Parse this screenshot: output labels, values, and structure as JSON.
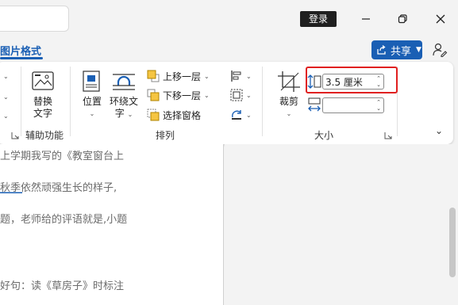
{
  "titlebar": {
    "login_label": "登录"
  },
  "tabs": {
    "active_label": "图片格式",
    "share_label": "共享"
  },
  "ribbon": {
    "accessibility": {
      "alt_text_line1": "替换",
      "alt_text_line2": "文字",
      "group_label": "辅助功能"
    },
    "arrange": {
      "position_label": "位置",
      "wrap_text_line1": "环绕文",
      "wrap_text_line2": "字",
      "bring_forward_label": "上移一层",
      "send_backward_label": "下移一层",
      "selection_pane_label": "选择窗格",
      "group_label": "排列"
    },
    "size": {
      "crop_label": "裁剪",
      "height_value": "3.5 厘米",
      "width_value": "",
      "group_label": "大小"
    }
  },
  "document": {
    "lines": [
      "上学期我写的《教室窗台上",
      "秋季依然顽强生长的样子,",
      "题，老师给的评语就是,小题",
      "好句：读《草房子》时标注"
    ]
  },
  "colors": {
    "accent": "#1a5fb4",
    "highlight": "#e02020"
  }
}
